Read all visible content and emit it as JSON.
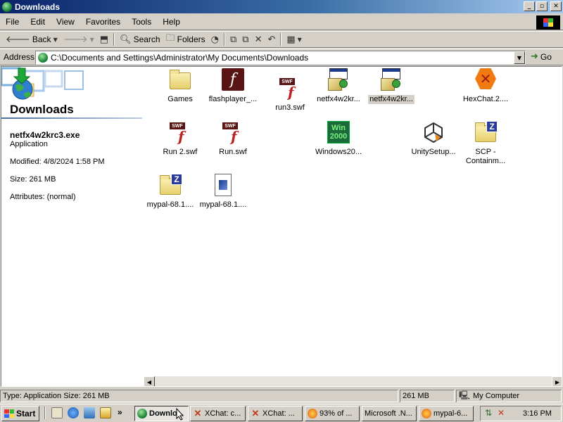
{
  "window": {
    "title": "Downloads"
  },
  "menu": [
    "File",
    "Edit",
    "View",
    "Favorites",
    "Tools",
    "Help"
  ],
  "toolbar": {
    "back": "Back",
    "search": "Search",
    "folders": "Folders"
  },
  "address": {
    "label": "Address",
    "path": "C:\\Documents and Settings\\Administrator\\My Documents\\Downloads",
    "go": "Go"
  },
  "left_panel": {
    "title": "Downloads",
    "selected_name": "netfx4w2krc3.exe",
    "selected_type": "Application",
    "modified": "Modified: 4/8/2024 1:58 PM",
    "size": "Size: 261 MB",
    "attributes": "Attributes: (normal)"
  },
  "files": [
    {
      "label": "Games",
      "icon": "folder-icon"
    },
    {
      "label": "flashplayer_...",
      "icon": "flash-icon"
    },
    {
      "label": "run3.swf",
      "icon": "swf-icon"
    },
    {
      "label": "netfx4w2kr...",
      "icon": "setup-icon"
    },
    {
      "label": "netfx4w2kr...",
      "icon": "setup-icon",
      "selected": true
    },
    {
      "label": "HexChat.2....",
      "icon": "hexchat-icon"
    },
    {
      "label": "Run 2.swf",
      "icon": "swf-icon"
    },
    {
      "label": "Run.swf",
      "icon": "swf-icon"
    },
    {
      "label": "Windows20...",
      "icon": "win2000-icon"
    },
    {
      "label": "UnitySetup...",
      "icon": "unity-icon"
    },
    {
      "label": "SCP -\nContainm...",
      "icon": "zip-folder-icon"
    },
    {
      "label": "mypal-68.1....",
      "icon": "zip-folder-icon"
    },
    {
      "label": "mypal-68.1....",
      "icon": "exe-icon"
    }
  ],
  "status": {
    "info": "Type: Application Size: 261 MB",
    "size": "261 MB",
    "zone": "My Computer"
  },
  "taskbar": {
    "start": "Start",
    "tasks": [
      "Downlo...",
      "XChat: c...",
      "XChat: ...",
      "93% of ...",
      "Microsoft .N...",
      "mypal-6..."
    ],
    "clock": "3:16 PM"
  }
}
